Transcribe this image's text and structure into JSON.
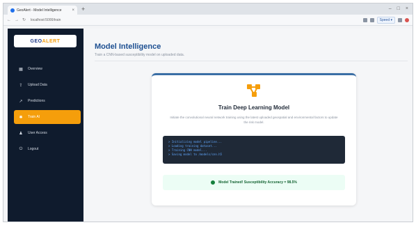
{
  "browser": {
    "tab_title": "GeoAlert - Model Intelligence",
    "new_tab": "+",
    "tab_close": "×",
    "url": "localhost:5000/train",
    "controls": [
      "–",
      "□",
      "×"
    ],
    "chip": "Speed ▾",
    "nav_back": "←",
    "nav_forward": "→",
    "nav_reload": "↻"
  },
  "sidebar": {
    "logo_part1": "GEO",
    "logo_part2": "ALERT",
    "items": [
      {
        "icon": "grid-icon",
        "glyph": "▦",
        "label": "Overview",
        "active": false
      },
      {
        "icon": "upload-icon",
        "glyph": "⇪",
        "label": "Upload Data",
        "active": false
      },
      {
        "icon": "chart-icon",
        "glyph": "↗",
        "label": "Predictions",
        "active": false
      },
      {
        "icon": "brain-icon",
        "glyph": "✱",
        "label": "Train AI",
        "active": true
      },
      {
        "icon": "users-icon",
        "glyph": "♟",
        "label": "User Access",
        "active": false
      },
      {
        "icon": "logout-icon",
        "glyph": "⏻",
        "label": "Logout",
        "active": false
      }
    ]
  },
  "main": {
    "title": "Model Intelligence",
    "subtitle": "Train a CNN-based susceptibility model on uploaded data.",
    "card": {
      "icon": "network-icon",
      "title": "Train Deep Learning Model",
      "description": "Initiate the convolutional neural network training using the latest uploaded geospatial and environmental factors to update the risk model.",
      "terminal_lines": [
        "> Initializing model pipeline...",
        "> Loading training dataset...",
        "> Training CNN model...",
        "> Saving model to /models/cnn.h5"
      ],
      "result_icon": "check-icon",
      "result_text": "Model Trained! Susceptibility Accuracy = 98.5%"
    }
  },
  "colors": {
    "sidebar_bg": "#0f1b2d",
    "accent": "#f59e0b",
    "title_blue": "#1d4f91",
    "terminal_bg": "#1f2937",
    "success_bg": "#ecfdf5",
    "success_text": "#166534"
  }
}
